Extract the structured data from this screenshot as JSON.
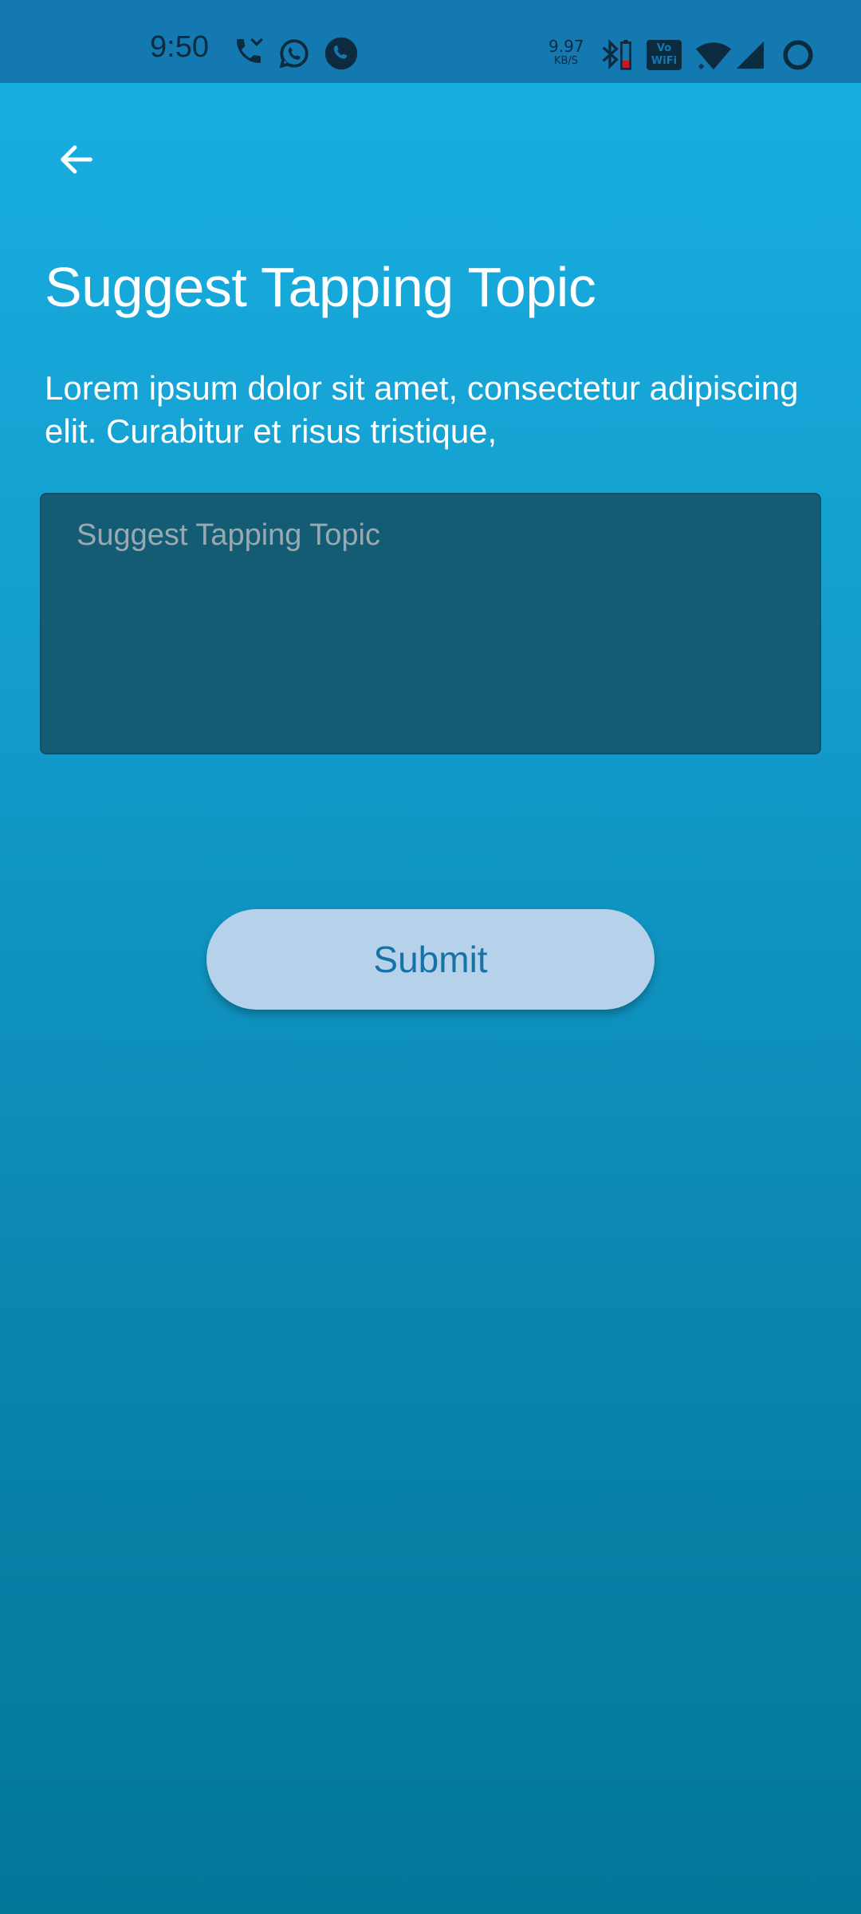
{
  "status_bar": {
    "time": "9:50",
    "network_speed_value": "9.97",
    "network_speed_unit": "KB/S",
    "vowifi_top": "Vo",
    "vowifi_bottom": "WiFi",
    "icons": [
      "missed-call-icon",
      "whatsapp-icon",
      "phone-call-icon",
      "bluetooth-icon",
      "battery-icon",
      "vowifi-icon",
      "wifi-icon",
      "signal-icon",
      "loading-ring-icon"
    ]
  },
  "header": {
    "back_icon": "arrow-left-icon"
  },
  "main": {
    "title": "Suggest Tapping Topic",
    "description": "Lorem ipsum dolor sit amet, consectetur adipiscing elit. Curabitur et risus tristique,",
    "input_placeholder": "Suggest Tapping Topic",
    "input_value": "",
    "submit_label": "Submit"
  },
  "colors": {
    "background_top": "#19b1e3",
    "background_bottom": "#03769a",
    "status_bar": "#1479b0",
    "input_bg": "#135c74",
    "button_bg": "#b6d1ea",
    "button_text": "#1772a8"
  }
}
